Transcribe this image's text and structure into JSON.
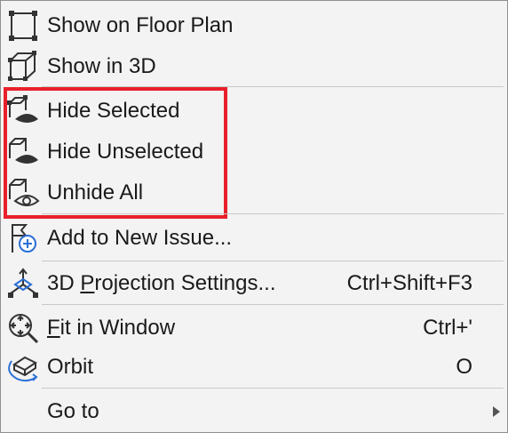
{
  "menu": {
    "items": [
      {
        "label": "Show on Floor Plan",
        "shortcut": "",
        "icon": "floor-plan-icon"
      },
      {
        "label": "Show in 3D",
        "shortcut": "",
        "icon": "3d-box-icon"
      },
      {
        "label": "Hide Selected",
        "shortcut": "",
        "icon": "hide-selected-icon"
      },
      {
        "label": "Hide Unselected",
        "shortcut": "",
        "icon": "hide-unselected-icon"
      },
      {
        "label": "Unhide All",
        "shortcut": "",
        "icon": "unhide-all-icon"
      },
      {
        "label": "Add to New Issue...",
        "shortcut": "",
        "icon": "add-issue-icon"
      },
      {
        "label_prefix": "3D ",
        "label_accel": "P",
        "label_rest": "rojection Settings...",
        "shortcut": "Ctrl+Shift+F3",
        "icon": "projection-settings-icon"
      },
      {
        "label_accel": "F",
        "label_rest": "it in Window",
        "shortcut": "Ctrl+'",
        "icon": "fit-in-window-icon"
      },
      {
        "label": "Orbit",
        "shortcut": "O",
        "icon": "orbit-icon"
      },
      {
        "label": "Go to",
        "shortcut": "",
        "icon": "",
        "submenu": true
      }
    ]
  },
  "colors": {
    "highlight_border": "#e8202b",
    "icon_blue": "#2a6fd6",
    "menu_background": "#f3f3f3"
  }
}
